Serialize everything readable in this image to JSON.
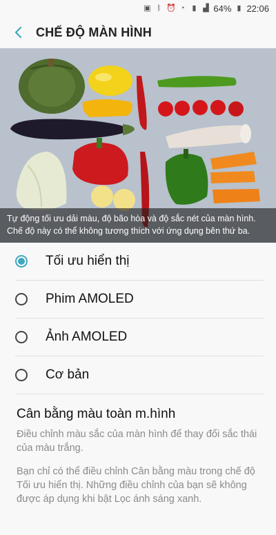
{
  "status": {
    "battery": "64%",
    "time": "22:06"
  },
  "header": {
    "title": "CHẾ ĐỘ MÀN HÌNH"
  },
  "hero": {
    "caption": "Tự động tối ưu dải màu, độ bão hòa và độ sắc nét của màn hình. Chế độ này có thể không tương thích với ứng dụng bên thứ ba."
  },
  "options": [
    {
      "label": "Tối ưu hiển thị",
      "selected": true
    },
    {
      "label": "Phim AMOLED",
      "selected": false
    },
    {
      "label": "Ảnh AMOLED",
      "selected": false
    },
    {
      "label": "Cơ bản",
      "selected": false
    }
  ],
  "color_balance": {
    "title": "Cân bằng màu toàn m.hình",
    "description": "Điều chỉnh màu sắc của màn hình để thay đổi sắc thái của màu trắng.",
    "note": "Bạn chỉ có thể điều chỉnh Cân bằng màu trong chế độ Tối ưu hiển thị. Những điều chỉnh của bạn sẽ không được áp dụng khi bật Lọc ánh sáng xanh."
  },
  "colors": {
    "accent": "#3fa7bf"
  }
}
